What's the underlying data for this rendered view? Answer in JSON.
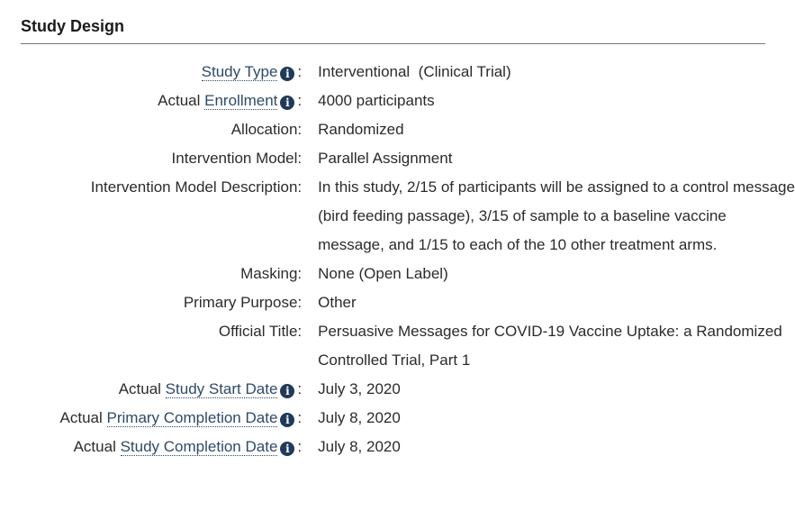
{
  "section": {
    "title": "Study Design"
  },
  "rows": [
    {
      "prefix": "",
      "term": "Study Type",
      "has_info": true,
      "value": "Interventional  (Clinical Trial)"
    },
    {
      "prefix": "Actual ",
      "term": "Enrollment",
      "has_info": true,
      "value": "4000 participants"
    },
    {
      "label": "Allocation:",
      "value": "Randomized"
    },
    {
      "label": "Intervention Model:",
      "value": "Parallel Assignment"
    },
    {
      "label": "Intervention Model Description:",
      "value": "In this study, 2/15 of participants will be assigned to a control message (bird feeding passage), 3/15 of sample to a baseline vaccine message, and 1/15 to each of the 10 other treatment arms."
    },
    {
      "label": "Masking:",
      "value": "None (Open Label)"
    },
    {
      "label": "Primary Purpose:",
      "value": "Other"
    },
    {
      "label": "Official Title:",
      "value": "Persuasive Messages for COVID-19 Vaccine Uptake: a Randomized Controlled Trial, Part 1"
    },
    {
      "prefix": "Actual ",
      "term": "Study Start Date",
      "has_info": true,
      "value": "July 3, 2020"
    },
    {
      "prefix": "Actual ",
      "term": "Primary Completion Date",
      "has_info": true,
      "value": "July 8, 2020"
    },
    {
      "prefix": "Actual ",
      "term": "Study Completion Date",
      "has_info": true,
      "value": "July 8, 2020"
    }
  ],
  "icons": {
    "info_glyph": "i",
    "colon": ":"
  },
  "colors": {
    "link": "#2e4a68",
    "info_icon_bg": "#1f3a5a",
    "text": "#2b2b2b",
    "rule": "#777777"
  }
}
